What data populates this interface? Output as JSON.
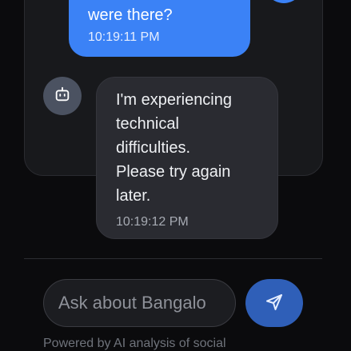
{
  "messages": [
    {
      "sender": "user",
      "text": "were there?",
      "time": "10:19:11 PM"
    },
    {
      "sender": "bot",
      "lines": [
        "I'm experiencing",
        "technical",
        "difficulties.",
        "Please try again",
        "later."
      ],
      "time": "10:19:12 PM"
    }
  ],
  "icons": {
    "bot_avatar": "robot-icon",
    "send": "send-icon"
  },
  "input": {
    "placeholder": "Ask about Bangalo",
    "value": ""
  },
  "footer": {
    "text": "Powered by AI analysis of social"
  },
  "colors": {
    "background": "#0b0b0d",
    "user_bubble": "#3b82f6",
    "bot_bubble": "#2a2b31",
    "send_button": "#2f5fb8"
  }
}
